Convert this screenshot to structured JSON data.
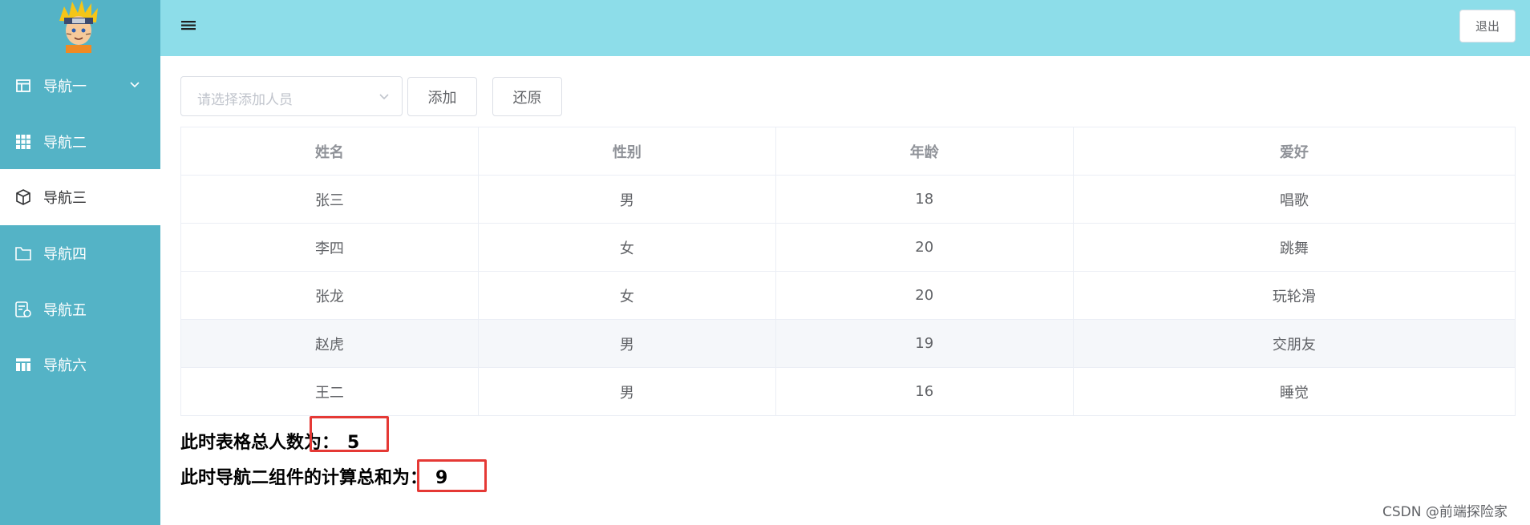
{
  "sidebar": {
    "logo_icon": "naruto-avatar",
    "items": [
      {
        "label": "导航一",
        "icon": "table-icon",
        "has_submenu": true
      },
      {
        "label": "导航二",
        "icon": "grid-icon"
      },
      {
        "label": "导航三",
        "icon": "cube-icon",
        "active": true
      },
      {
        "label": "导航四",
        "icon": "folder-icon"
      },
      {
        "label": "导航五",
        "icon": "calc-icon"
      },
      {
        "label": "导航六",
        "icon": "layout-icon"
      }
    ]
  },
  "header": {
    "menu_icon": "hamburger-icon",
    "logout_label": "退出"
  },
  "toolbar": {
    "select_placeholder": "请选择添加人员",
    "add_label": "添加",
    "reset_label": "还原"
  },
  "table": {
    "columns": [
      "姓名",
      "性别",
      "年龄",
      "爱好"
    ],
    "rows": [
      [
        "张三",
        "男",
        "18",
        "唱歌"
      ],
      [
        "李四",
        "女",
        "20",
        "跳舞"
      ],
      [
        "张龙",
        "女",
        "20",
        "玩轮滑"
      ],
      [
        "赵虎",
        "男",
        "19",
        "交朋友"
      ],
      [
        "王二",
        "男",
        "16",
        "睡觉"
      ]
    ]
  },
  "summary": {
    "total_label": "此时表格总人数为：",
    "total_value": "5",
    "calc_label": "此时导航二组件的计算总和为：",
    "calc_value": "9"
  },
  "watermark": "CSDN @前端探险家",
  "colors": {
    "sidebar_bg": "#54b3c6",
    "header_bg": "#8ddde9",
    "highlight_box": "#e53935"
  }
}
